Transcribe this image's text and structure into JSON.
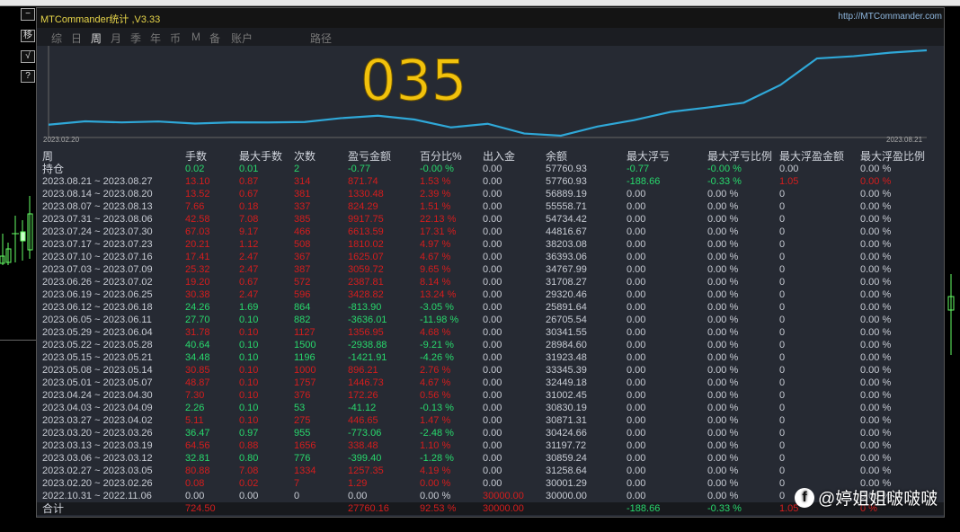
{
  "window": {
    "title": "MTCommander统计 ,V3.33",
    "url": "http://MTCommander.com"
  },
  "side_buttons": [
    "−",
    "移",
    "√",
    "?"
  ],
  "tabs": [
    {
      "label": "综"
    },
    {
      "label": "日"
    },
    {
      "label": "周",
      "active": true
    },
    {
      "label": "月"
    },
    {
      "label": "季"
    },
    {
      "label": "年"
    },
    {
      "label": "币"
    },
    {
      "label": "M"
    },
    {
      "label": "备"
    },
    {
      "label": "账户"
    },
    {
      "label": "路径"
    }
  ],
  "chart": {
    "overlay_number": "035",
    "start_label": "2023.02.20",
    "end_label": "2023.08.21",
    "line_color": "#2fa8d8"
  },
  "columns": [
    "周",
    "手数",
    "最大手数",
    "次数",
    "盈亏金额",
    "百分比%",
    "出入金",
    "余额",
    "最大浮亏",
    "最大浮亏比例",
    "最大浮盈金额",
    "最大浮盈比例"
  ],
  "open_position": {
    "label": "持仓",
    "lots": "0.02",
    "max_lots": "0.01",
    "count": "2",
    "profit": "-0.77",
    "pct": "-0.00 %",
    "deposit": "0.00",
    "balance": "57760.93",
    "max_dd": "-0.77",
    "max_dd_pct": "-0.00 %",
    "max_fp": "0.00",
    "max_fp_pct": "0.00 %"
  },
  "rows": [
    [
      "2023.08.21 ~ 2023.08.27",
      "13.10",
      "0.87",
      "314",
      "871.74",
      "1.53 %",
      "0.00",
      "57760.93",
      "-188.66",
      "-0.33 %",
      "1.05",
      "0.00 %",
      "r"
    ],
    [
      "2023.08.14 ~ 2023.08.20",
      "13.52",
      "0.67",
      "381",
      "1330.48",
      "2.39 %",
      "0.00",
      "56889.19",
      "0.00",
      "0.00 %",
      "0",
      "0.00 %",
      "r"
    ],
    [
      "2023.08.07 ~ 2023.08.13",
      "7.66",
      "0.18",
      "337",
      "824.29",
      "1.51 %",
      "0.00",
      "55558.71",
      "0.00",
      "0.00 %",
      "0",
      "0.00 %",
      "r"
    ],
    [
      "2023.07.31 ~ 2023.08.06",
      "42.58",
      "7.08",
      "385",
      "9917.75",
      "22.13 %",
      "0.00",
      "54734.42",
      "0.00",
      "0.00 %",
      "0",
      "0.00 %",
      "r"
    ],
    [
      "2023.07.24 ~ 2023.07.30",
      "67.03",
      "9.17",
      "466",
      "6613.59",
      "17.31 %",
      "0.00",
      "44816.67",
      "0.00",
      "0.00 %",
      "0",
      "0.00 %",
      "r"
    ],
    [
      "2023.07.17 ~ 2023.07.23",
      "20.21",
      "1.12",
      "508",
      "1810.02",
      "4.97 %",
      "0.00",
      "38203.08",
      "0.00",
      "0.00 %",
      "0",
      "0.00 %",
      "r"
    ],
    [
      "2023.07.10 ~ 2023.07.16",
      "17.41",
      "2.47",
      "367",
      "1625.07",
      "4.67 %",
      "0.00",
      "36393.06",
      "0.00",
      "0.00 %",
      "0",
      "0.00 %",
      "r"
    ],
    [
      "2023.07.03 ~ 2023.07.09",
      "25.32",
      "2.47",
      "387",
      "3059.72",
      "9.65 %",
      "0.00",
      "34767.99",
      "0.00",
      "0.00 %",
      "0",
      "0.00 %",
      "r"
    ],
    [
      "2023.06.26 ~ 2023.07.02",
      "19.20",
      "0.67",
      "572",
      "2387.81",
      "8.14 %",
      "0.00",
      "31708.27",
      "0.00",
      "0.00 %",
      "0",
      "0.00 %",
      "r"
    ],
    [
      "2023.06.19 ~ 2023.06.25",
      "30.38",
      "2.47",
      "596",
      "3428.82",
      "13.24 %",
      "0.00",
      "29320.46",
      "0.00",
      "0.00 %",
      "0",
      "0.00 %",
      "r"
    ],
    [
      "2023.06.12 ~ 2023.06.18",
      "24.26",
      "1.69",
      "864",
      "-813.90",
      "-3.05 %",
      "0.00",
      "25891.64",
      "0.00",
      "0.00 %",
      "0",
      "0.00 %",
      "g"
    ],
    [
      "2023.06.05 ~ 2023.06.11",
      "27.70",
      "0.10",
      "882",
      "-3636.01",
      "-11.98 %",
      "0.00",
      "26705.54",
      "0.00",
      "0.00 %",
      "0",
      "0.00 %",
      "g"
    ],
    [
      "2023.05.29 ~ 2023.06.04",
      "31.78",
      "0.10",
      "1127",
      "1356.95",
      "4.68 %",
      "0.00",
      "30341.55",
      "0.00",
      "0.00 %",
      "0",
      "0.00 %",
      "r"
    ],
    [
      "2023.05.22 ~ 2023.05.28",
      "40.64",
      "0.10",
      "1500",
      "-2938.88",
      "-9.21 %",
      "0.00",
      "28984.60",
      "0.00",
      "0.00 %",
      "0",
      "0.00 %",
      "g"
    ],
    [
      "2023.05.15 ~ 2023.05.21",
      "34.48",
      "0.10",
      "1196",
      "-1421.91",
      "-4.26 %",
      "0.00",
      "31923.48",
      "0.00",
      "0.00 %",
      "0",
      "0.00 %",
      "g"
    ],
    [
      "2023.05.08 ~ 2023.05.14",
      "30.85",
      "0.10",
      "1000",
      "896.21",
      "2.76 %",
      "0.00",
      "33345.39",
      "0.00",
      "0.00 %",
      "0",
      "0.00 %",
      "r"
    ],
    [
      "2023.05.01 ~ 2023.05.07",
      "48.87",
      "0.10",
      "1757",
      "1446.73",
      "4.67 %",
      "0.00",
      "32449.18",
      "0.00",
      "0.00 %",
      "0",
      "0.00 %",
      "r"
    ],
    [
      "2023.04.24 ~ 2023.04.30",
      "7.30",
      "0.10",
      "376",
      "172.26",
      "0.56 %",
      "0.00",
      "31002.45",
      "0.00",
      "0.00 %",
      "0",
      "0.00 %",
      "r"
    ],
    [
      "2023.04.03 ~ 2023.04.09",
      "2.26",
      "0.10",
      "53",
      "-41.12",
      "-0.13 %",
      "0.00",
      "30830.19",
      "0.00",
      "0.00 %",
      "0",
      "0.00 %",
      "g"
    ],
    [
      "2023.03.27 ~ 2023.04.02",
      "5.11",
      "0.10",
      "275",
      "446.65",
      "1.47 %",
      "0.00",
      "30871.31",
      "0.00",
      "0.00 %",
      "0",
      "0.00 %",
      "r"
    ],
    [
      "2023.03.20 ~ 2023.03.26",
      "36.47",
      "0.97",
      "955",
      "-773.06",
      "-2.48 %",
      "0.00",
      "30424.66",
      "0.00",
      "0.00 %",
      "0",
      "0.00 %",
      "g"
    ],
    [
      "2023.03.13 ~ 2023.03.19",
      "64.56",
      "0.88",
      "1656",
      "338.48",
      "1.10 %",
      "0.00",
      "31197.72",
      "0.00",
      "0.00 %",
      "0",
      "0.00 %",
      "r"
    ],
    [
      "2023.03.06 ~ 2023.03.12",
      "32.81",
      "0.80",
      "776",
      "-399.40",
      "-1.28 %",
      "0.00",
      "30859.24",
      "0.00",
      "0.00 %",
      "0",
      "0.00 %",
      "g"
    ],
    [
      "2023.02.27 ~ 2023.03.05",
      "80.88",
      "7.08",
      "1334",
      "1257.35",
      "4.19 %",
      "0.00",
      "31258.64",
      "0.00",
      "0.00 %",
      "0",
      "0.00 %",
      "r"
    ],
    [
      "2023.02.20 ~ 2023.02.26",
      "0.08",
      "0.02",
      "7",
      "1.29",
      "0.00 %",
      "0.00",
      "30001.29",
      "0.00",
      "0.00 %",
      "0",
      "0.00 %",
      "r"
    ],
    [
      "2022.10.31 ~ 2022.11.06",
      "0.00",
      "0.00",
      "0",
      "0.00",
      "0.00 %",
      "30000.00",
      "30000.00",
      "0.00",
      "0.00 %",
      "0",
      "0.00 %",
      "n"
    ]
  ],
  "total": {
    "label": "合计",
    "lots": "724.50",
    "profit": "27760.16",
    "pct": "92.53 %",
    "deposit": "30000.00",
    "max_dd": "-188.66",
    "max_dd_pct": "-0.33 %",
    "max_fp": "1.05",
    "max_fp_pct": "0 %"
  },
  "watermark": "@婷姐姐啵啵啵",
  "colors": {
    "profit": "#d51d1d",
    "loss": "#28d86c",
    "text": "#c8ccd4",
    "title": "#e8d64a"
  }
}
